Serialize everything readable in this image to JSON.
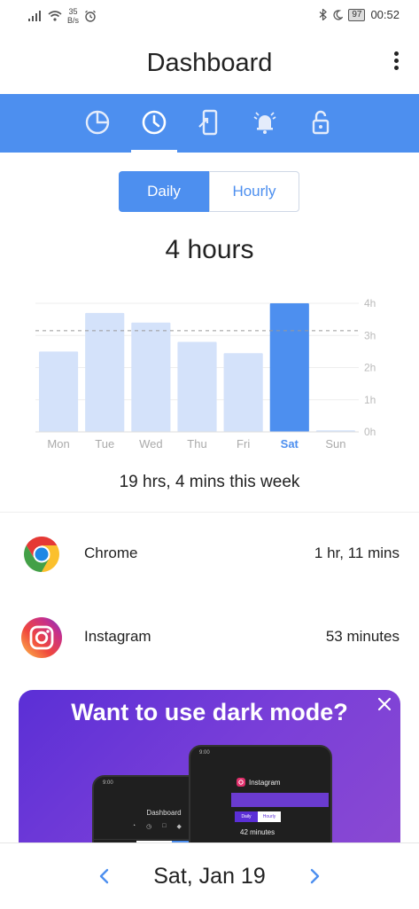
{
  "status_bar": {
    "speed_value": "35",
    "speed_unit": "B/s",
    "battery": "97",
    "time": "00:52"
  },
  "header": {
    "title": "Dashboard"
  },
  "tabs": [
    {
      "name": "usage-pie",
      "icon": "pie-chart-icon"
    },
    {
      "name": "timeline",
      "icon": "clock-icon"
    },
    {
      "name": "unlocks",
      "icon": "phone-unlock-icon"
    },
    {
      "name": "notifications",
      "icon": "bell-icon"
    },
    {
      "name": "lock",
      "icon": "unlock-icon"
    }
  ],
  "view_toggle": {
    "daily": "Daily",
    "hourly": "Hourly",
    "selected": "Daily"
  },
  "total_today": "4 hours",
  "chart_data": {
    "type": "bar",
    "categories": [
      "Mon",
      "Tue",
      "Wed",
      "Thu",
      "Fri",
      "Sat",
      "Sun"
    ],
    "values": [
      2.5,
      3.7,
      3.4,
      2.8,
      2.45,
      4.0,
      0.05
    ],
    "highlighted": "Sat",
    "average_line": 3.15,
    "y_ticks": [
      "0h",
      "1h",
      "2h",
      "3h",
      "4h"
    ],
    "ylim": [
      0,
      4
    ],
    "colors": {
      "bar": "#d4e2fa",
      "highlight": "#4d8fef",
      "avg_line": "#999999"
    }
  },
  "week_total": "19 hrs, 4 mins this week",
  "apps": [
    {
      "name": "Chrome",
      "time": "1 hr, 11 mins",
      "icon": "chrome-icon"
    },
    {
      "name": "Instagram",
      "time": "53 minutes",
      "icon": "instagram-icon"
    }
  ],
  "promo": {
    "title": "Want to use dark mode?",
    "mock_back": {
      "time": "9:00",
      "title": "Dashboard"
    },
    "mock_front": {
      "time": "9:00",
      "app": "Instagram",
      "daily": "Daily",
      "hourly": "Hourly",
      "value": "42 minutes"
    }
  },
  "footer": {
    "date": "Sat, Jan 19"
  },
  "colors": {
    "accent": "#4d8fef",
    "promo_start": "#5b2fd6",
    "promo_end": "#8a49d2"
  }
}
